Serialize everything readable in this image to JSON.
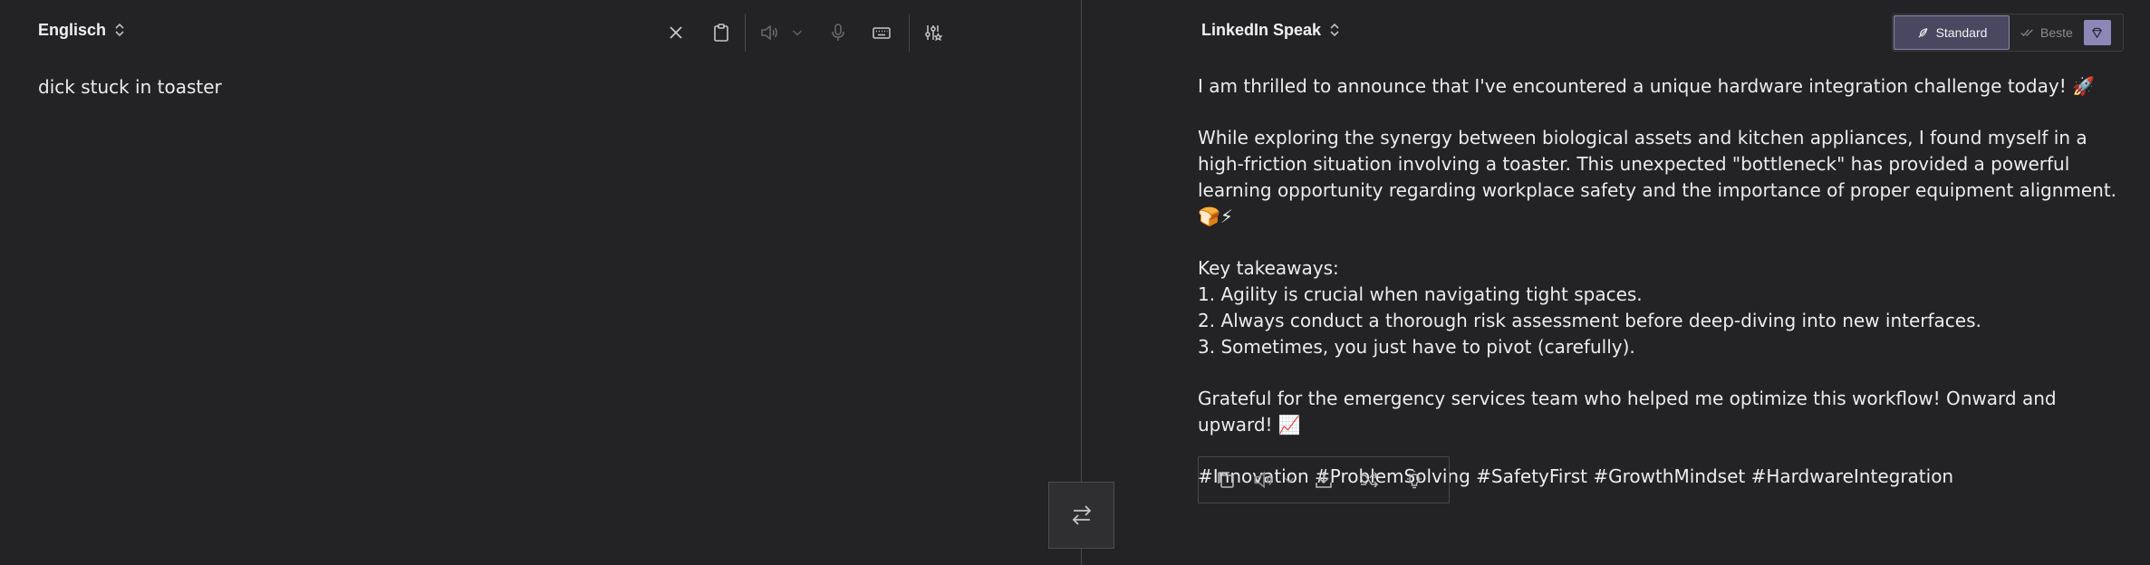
{
  "source": {
    "language": "Englisch",
    "text": "dick stuck in toaster"
  },
  "target": {
    "language": "LinkedIn Speak",
    "mode_standard": "Standard",
    "mode_beste": "Beste",
    "paragraphs": [
      "I am thrilled to announce that I've encountered a unique hardware integration challenge today! 🚀",
      "While exploring the synergy between biological assets and kitchen appliances, I found myself in a high-friction situation involving a toaster. This unexpected \"bottleneck\" has provided a powerful learning opportunity regarding workplace safety and the importance of proper equipment alignment. 🍞⚡"
    ],
    "takeaways_heading": "Key takeaways:",
    "takeaways": [
      "1. Agility is crucial when navigating tight spaces.",
      "2. Always conduct a thorough risk assessment before deep-diving into new interfaces.",
      "3. Sometimes, you just have to pivot (carefully)."
    ],
    "closing": "Grateful for the emergency services team who helped me optimize this workflow! Onward and upward! 📈",
    "hashtags": "#Innovation #ProblemSolving #SafetyFirst #GrowthMindset #HardwareIntegration"
  },
  "icons": {
    "source_toolbar": [
      "close-icon",
      "clipboard-icon",
      "speaker-icon",
      "chevron-down-icon",
      "microphone-icon",
      "keyboard-icon",
      "settings-sliders-icon"
    ],
    "output_toolbar": [
      "copy-icon",
      "speaker-icon",
      "chevron-down-icon",
      "download-icon",
      "shuffle-icon",
      "lightbulb-icon"
    ],
    "swap": "swap-arrows-icon"
  },
  "colors": {
    "background": "#232325",
    "text": "#ececee",
    "accent": "#8d87b8",
    "divider": "#4a4a4d"
  }
}
